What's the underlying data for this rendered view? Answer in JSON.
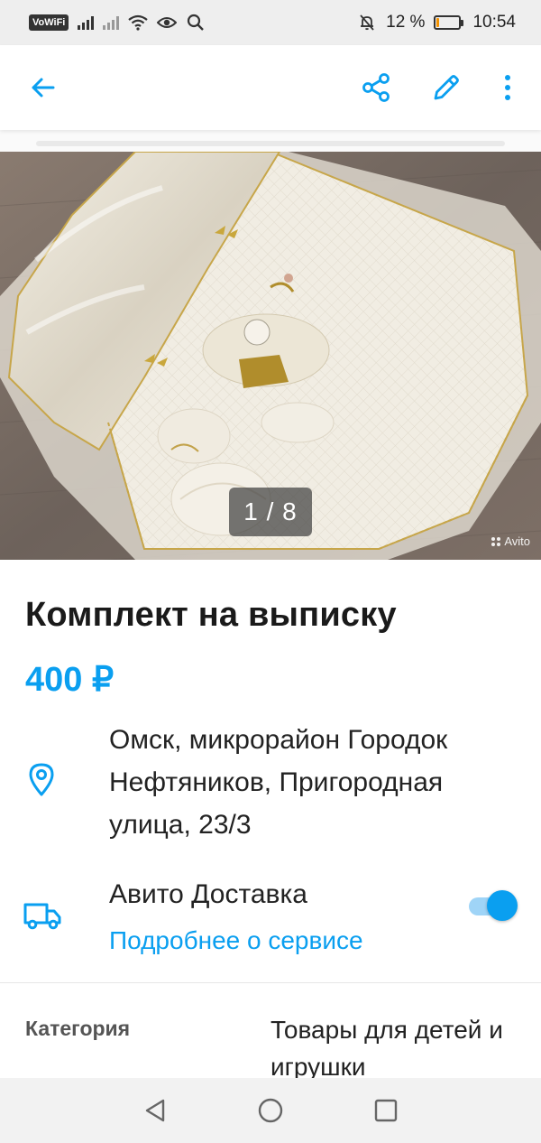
{
  "status_bar": {
    "vowifi": "VoWiFi",
    "battery_percent": "12 %",
    "battery_level": 0.12,
    "time": "10:54"
  },
  "app_bar": {
    "icons": [
      "back-arrow-icon",
      "share-icon",
      "edit-pencil-icon",
      "more-vertical-icon"
    ]
  },
  "gallery": {
    "counter": "1 / 8",
    "current_image": 1,
    "total_images": 8,
    "watermark": "Avito"
  },
  "listing": {
    "title": "Комплект на выписку",
    "price": "400 ₽"
  },
  "location": {
    "address": "Омск, микрорайон Городок Нефтяников, Пригородная улица, 23/3"
  },
  "delivery": {
    "title": "Авито Доставка",
    "link": "Подробнее о сервисе",
    "enabled": true
  },
  "params": {
    "category_label": "Категория",
    "category_value": "Товары для детей и игрушки"
  },
  "colors": {
    "accent": "#0a9ff0",
    "text": "#222222",
    "battery": "#f39200"
  },
  "nav_bar": {
    "icons": [
      "back-triangle-icon",
      "home-circle-icon",
      "recents-square-icon"
    ]
  }
}
